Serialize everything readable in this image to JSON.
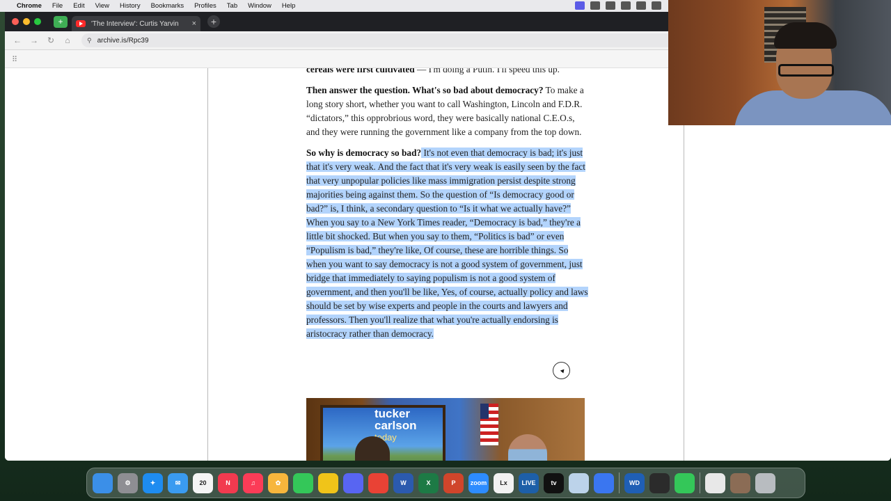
{
  "menubar": {
    "apple": "",
    "items": [
      "Chrome",
      "File",
      "Edit",
      "View",
      "History",
      "Bookmarks",
      "Profiles",
      "Tab",
      "Window",
      "Help"
    ]
  },
  "browser": {
    "tab_title": "'The Interview': Curtis Yarvin",
    "tab_close": "×",
    "new_tab": "+",
    "url": "archive.is/Rpc39",
    "apps_icon": "⠿"
  },
  "article": {
    "p0_bold": "cereals were first cultivated",
    "p0_rest": " — I'm doing a Putin. I'll speed this up.",
    "p1_bold": "Then answer the question. What's so bad about democracy?",
    "p1_rest": " To make a long story short, whether you want to call Washington, Lincoln and F.D.R. “dictators,” this opprobrious word, they were basically national C.E.O.s, and they were running the government like a company from the top down.",
    "p2_bold": "So why is democracy so bad?",
    "p2_rest": " It's not even that democracy is bad; it's just that it's very weak. And the fact that it's very weak is easily seen by the fact that very unpopular policies like mass immigration persist despite strong majorities being against them. So the question of “Is democracy good or bad?” is, I think, a secondary question to “Is it what we actually have?” When you say to a New York Times reader, “Democracy is bad,” they're a little bit shocked. But when you say to them, “Politics is bad” or even “Populism is bad,” they're like, Of course, these are horrible things. So when you want to say democracy is not a good system of government, just bridge that immediately to saying populism is not a good system of government, and then you'll be like, Yes, of course, actually policy and laws should be set by wise experts and people in the courts and lawyers and professors. Then you'll realize that what you're actually endorsing is aristocracy rather than democracy.",
    "video_brand_1": "tucker",
    "video_brand_2": "carlson",
    "video_brand_3": "today"
  },
  "colors": {
    "selection": "#b3d4fc",
    "tabbar": "#1f2024",
    "close_red": "#fe5f57",
    "min_yellow": "#febc2e",
    "max_green": "#28c840"
  },
  "dock": [
    {
      "name": "finder-icon",
      "label": "",
      "color": "#3b8fe8"
    },
    {
      "name": "system-settings-icon",
      "label": "⚙",
      "color": "#8e8e93"
    },
    {
      "name": "safari-icon",
      "label": "✦",
      "color": "#1e8cf0"
    },
    {
      "name": "mail-icon",
      "label": "✉",
      "color": "#3a9bf0"
    },
    {
      "name": "calendar-icon",
      "label": "20",
      "color": "#f5f5f5"
    },
    {
      "name": "news-icon",
      "label": "N",
      "color": "#f23a4f"
    },
    {
      "name": "music-icon",
      "label": "♫",
      "color": "#fb3c57"
    },
    {
      "name": "photos-icon",
      "label": "✿",
      "color": "#f7b63c"
    },
    {
      "name": "messages-icon",
      "label": "",
      "color": "#34c759"
    },
    {
      "name": "tes-icon",
      "label": "",
      "color": "#f0c419"
    },
    {
      "name": "discord-icon",
      "label": "",
      "color": "#5865f2"
    },
    {
      "name": "chrome-icon",
      "label": "",
      "color": "#e94235"
    },
    {
      "name": "word-icon",
      "label": "W",
      "color": "#2b5aae"
    },
    {
      "name": "excel-icon",
      "label": "X",
      "color": "#1d7a45"
    },
    {
      "name": "powerpoint-icon",
      "label": "P",
      "color": "#d0452b"
    },
    {
      "name": "zoom-icon",
      "label": "zoom",
      "color": "#2d8cff"
    },
    {
      "name": "lx-icon",
      "label": "Lx",
      "color": "#f2f2f2"
    },
    {
      "name": "live-icon",
      "label": "LIVE",
      "color": "#1d5fa8"
    },
    {
      "name": "apple-tv-icon",
      "label": "tv",
      "color": "#111111"
    },
    {
      "name": "preview-icon",
      "label": "",
      "color": "#bcd3ea"
    },
    {
      "name": "signal-icon",
      "label": "",
      "color": "#3a76f0"
    },
    {
      "name": "wd-icon",
      "label": "WD",
      "color": "#1f5fb5"
    },
    {
      "name": "activity-monitor-icon",
      "label": "",
      "color": "#2b2b2b"
    },
    {
      "name": "facetime-icon",
      "label": "",
      "color": "#34c759"
    },
    {
      "name": "document-icon",
      "label": "",
      "color": "#e8e8e8"
    },
    {
      "name": "downloads-stack-icon",
      "label": "",
      "color": "#8b6c55"
    },
    {
      "name": "trash-icon",
      "label": "",
      "color": "#b8bcc0"
    }
  ]
}
